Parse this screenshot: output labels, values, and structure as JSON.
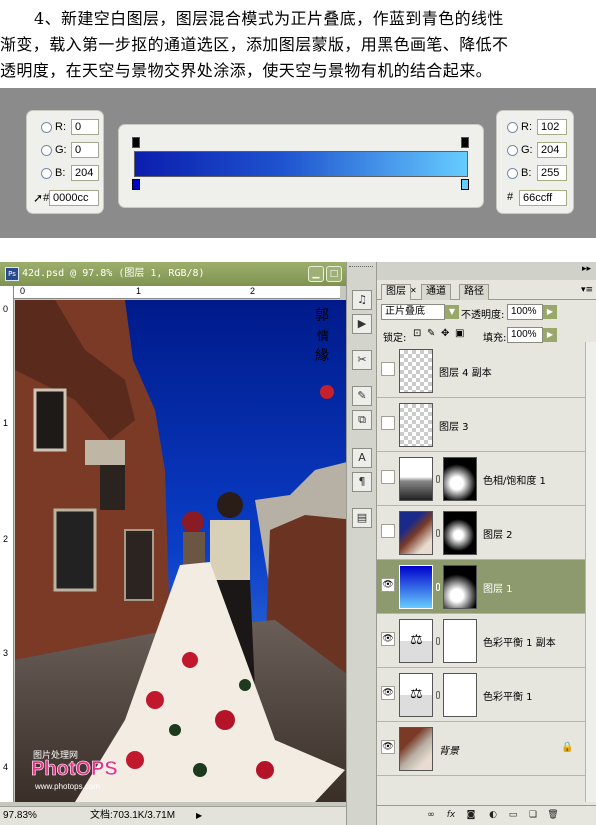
{
  "instructions": {
    "line1": "4、新建空白图层，图层混合模式为正片叠底，作蓝到青色的线性",
    "line2": "渐变，载入第一步抠的通道选区，添加图层蒙版，用黑色画笔、降低不",
    "line3": "透明度，在天空与景物交界处涂添，使天空与景物有机的结合起来。"
  },
  "gradient_editor": {
    "left_color": {
      "r_label": "R:",
      "g_label": "G:",
      "b_label": "B:",
      "r": "0",
      "g": "0",
      "b": "204",
      "hex_label": "#",
      "hex": "0000cc"
    },
    "right_color": {
      "r_label": "R:",
      "g_label": "G:",
      "b_label": "B:",
      "r": "102",
      "g": "204",
      "b": "255",
      "hex_label": "#",
      "hex": "66ccff"
    },
    "start_color": "#0000cc",
    "end_color": "#66ccff"
  },
  "document": {
    "title": "42d.psd @ 97.8% (图层 1, RGB/8)",
    "ruler_h": [
      "0",
      "1",
      "2"
    ],
    "ruler_v": [
      "0",
      "1",
      "2",
      "3",
      "4"
    ],
    "zoom": "97.83%",
    "doc_info": "文档:703.1K/3.71M",
    "watermark_top": "图片处理网",
    "watermark_logo": "PhotOPS",
    "watermark_url": "www.photops.com"
  },
  "layers_panel": {
    "tabs": [
      "图层",
      "通道",
      "路径"
    ],
    "blend_mode": "正片叠底",
    "opacity_label": "不透明度:",
    "opacity": "100%",
    "lock_label": "锁定:",
    "fill_label": "填充:",
    "fill": "100%",
    "layers": [
      {
        "name": "图层 4 副本",
        "visible": false,
        "selected": false,
        "thumb": "checker",
        "mask": false
      },
      {
        "name": "图层 3",
        "visible": false,
        "selected": false,
        "thumb": "checker",
        "mask": false
      },
      {
        "name": "色相/饱和度 1",
        "visible": false,
        "selected": false,
        "thumb": "adjust-gradient",
        "mask": true
      },
      {
        "name": "图层 2",
        "visible": false,
        "selected": false,
        "thumb": "photo",
        "mask": true
      },
      {
        "name": "图层 1",
        "visible": true,
        "selected": true,
        "thumb": "blue-gradient",
        "mask": true
      },
      {
        "name": "色彩平衡 1 副本",
        "visible": true,
        "selected": false,
        "thumb": "balance",
        "mask": true
      },
      {
        "name": "色彩平衡 1",
        "visible": true,
        "selected": false,
        "thumb": "balance",
        "mask": true
      },
      {
        "name": "背景",
        "visible": true,
        "selected": false,
        "thumb": "photo",
        "mask": false
      }
    ]
  }
}
